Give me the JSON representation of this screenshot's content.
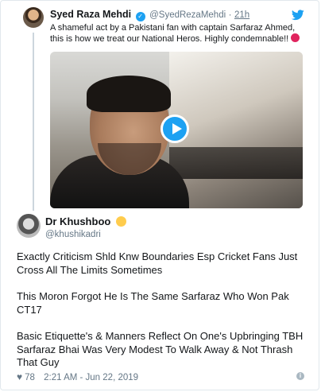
{
  "quoted_tweet": {
    "author_name": "Syed Raza Mehdi",
    "handle": "@SyedRezaMehdi",
    "separator": "·",
    "time": "21h",
    "text": "A shameful act by a Pakistani fan with captain Sarfaraz Ahmed, this is how we treat our National Heros. Highly condemnable!!",
    "media": {
      "type": "video",
      "play_icon": "play-icon"
    }
  },
  "tweet": {
    "author_name": "Dr Khushboo",
    "handle": "@khushikadri",
    "paragraphs": [
      "Exactly Criticism Shld Knw Boundaries Esp Cricket Fans Just Cross All The Limits Sometimes",
      "This Moron Forgot He Is The Same Sarfaraz  Who Won Pak CT17",
      "Basic Etiquette's & Manners Reflect On One's Upbringing TBH Sarfaraz Bhai Was Very Modest To Walk Away & Not Thrash That Guy"
    ],
    "likes": "78",
    "timestamp": "2:21 AM - Jun 22, 2019"
  },
  "colors": {
    "accent": "#1da1f2",
    "muted": "#657786",
    "border": "#e1e8ed"
  }
}
